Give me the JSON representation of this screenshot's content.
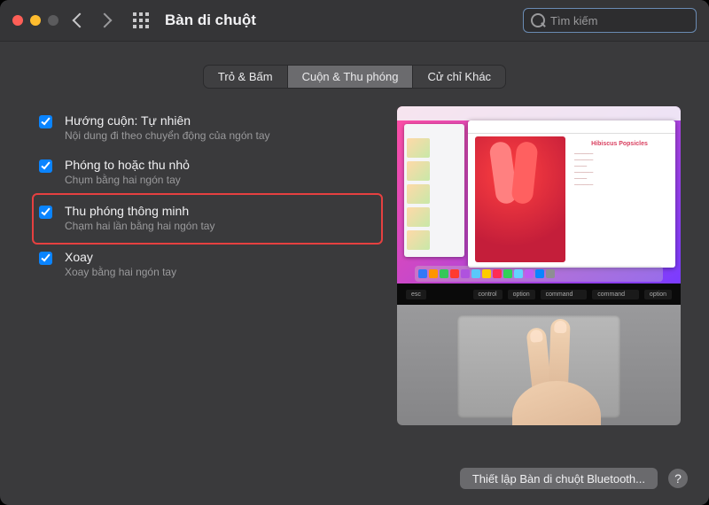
{
  "window": {
    "title": "Bàn di chuột"
  },
  "search": {
    "placeholder": "Tìm kiếm"
  },
  "tabs": {
    "point_click": "Trỏ & Bấm",
    "scroll_zoom": "Cuộn & Thu phóng",
    "more_gestures": "Cử chỉ Khác",
    "active": "scroll_zoom"
  },
  "options": {
    "natural_scroll": {
      "label": "Hướng cuộn: Tự nhiên",
      "desc": "Nội dung đi theo chuyển động của ngón tay",
      "checked": true
    },
    "zoom": {
      "label": "Phóng to hoặc thu nhỏ",
      "desc": "Chụm bằng hai ngón tay",
      "checked": true
    },
    "smart_zoom": {
      "label": "Thu phóng thông minh",
      "desc": "Chạm hai lần bằng hai ngón tay",
      "checked": true
    },
    "rotate": {
      "label": "Xoay",
      "desc": "Xoay bằng hai ngón tay",
      "checked": true
    }
  },
  "preview": {
    "recipe_title": "Hibiscus Popsicles",
    "touchbar": {
      "esc": "esc",
      "ctrl": "control",
      "opt1": "option",
      "cmd1": "command",
      "cmd2": "command",
      "opt2": "option"
    }
  },
  "footer": {
    "bluetooth_btn": "Thiết lập Bàn di chuột Bluetooth...",
    "help": "?"
  },
  "colors": {
    "accent": "#0a84ff",
    "highlight_border": "#e64040"
  }
}
